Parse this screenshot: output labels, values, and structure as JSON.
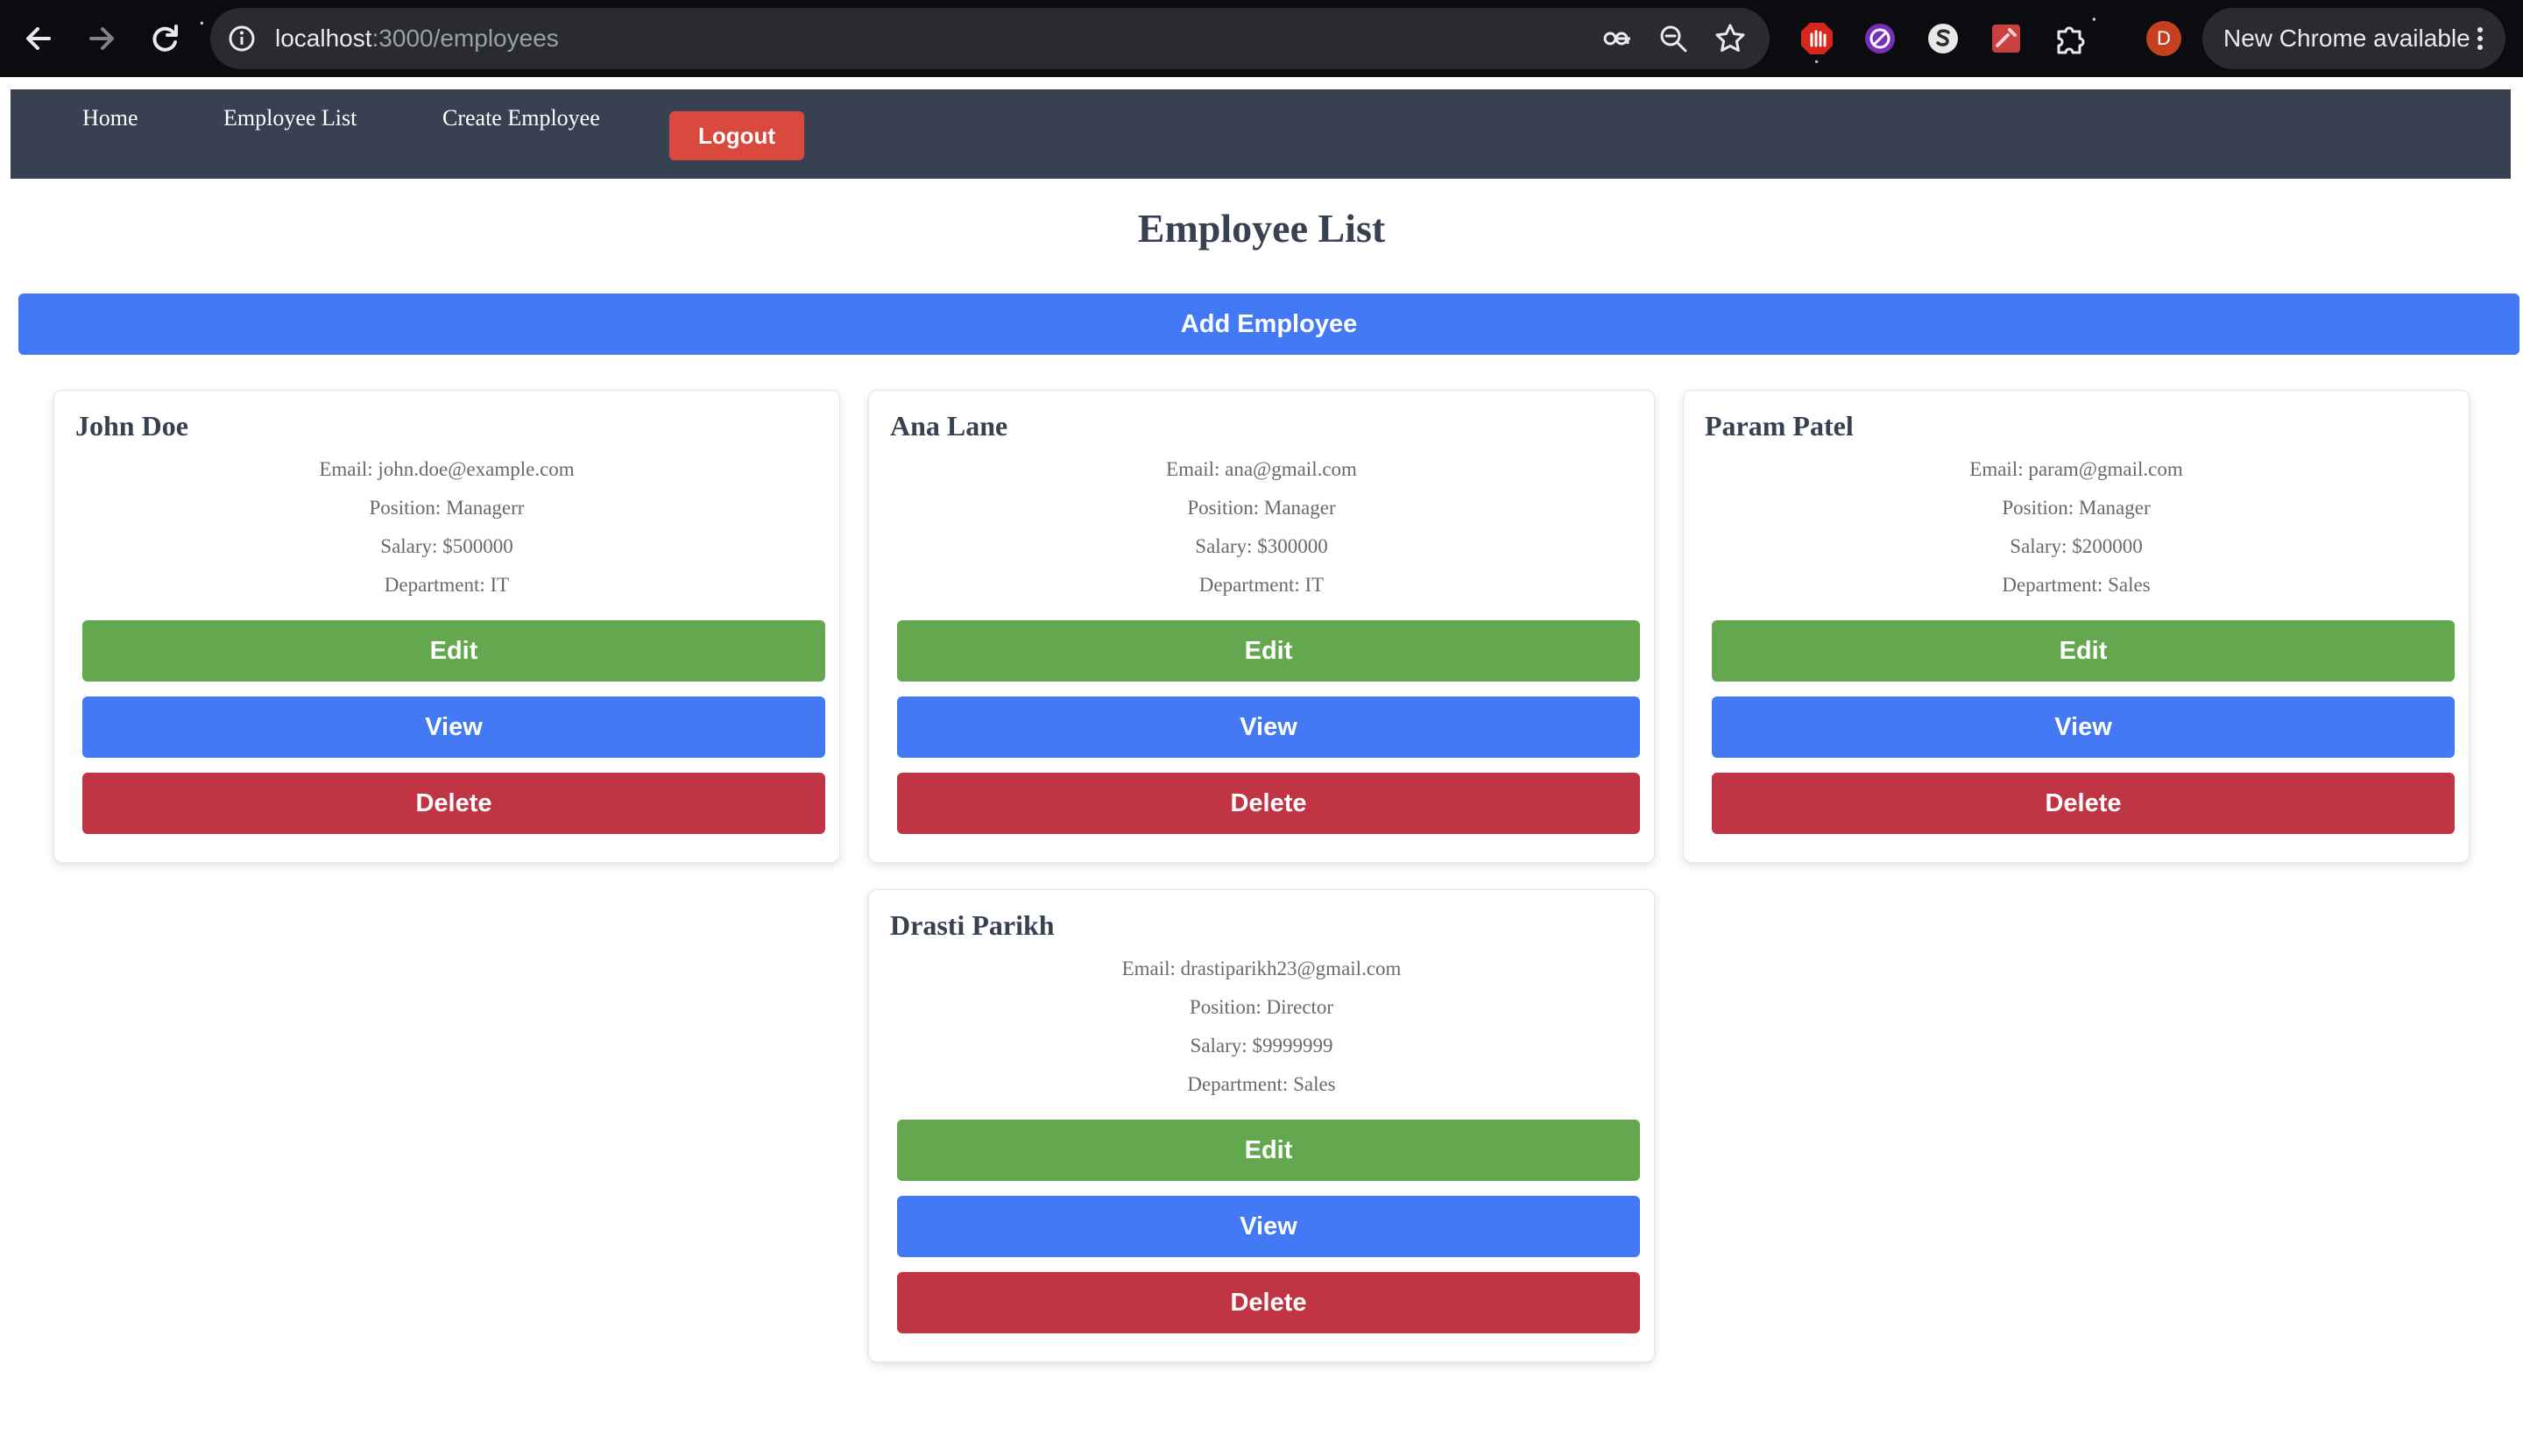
{
  "browser": {
    "url_host": "localhost",
    "url_path": ":3000/employees",
    "profile_initial": "D",
    "update_label": "New Chrome available",
    "icons": [
      "back-arrow-icon",
      "forward-arrow-icon",
      "reload-icon",
      "site-info-icon",
      "password-key-icon",
      "zoom-icon",
      "bookmark-star-icon",
      "extensions-icon",
      "more-menu-icon"
    ]
  },
  "navbar": {
    "links": [
      "Home",
      "Employee List",
      "Create Employee"
    ],
    "logout_label": "Logout"
  },
  "page": {
    "title": "Employee List",
    "add_label": "Add Employee"
  },
  "employees": [
    {
      "name": "John Doe",
      "email": "Email: john.doe@example.com",
      "position": "Position: Managerr",
      "salary": "Salary: $500000",
      "department": "Department: IT"
    },
    {
      "name": "Ana Lane",
      "email": "Email: ana@gmail.com",
      "position": "Position: Manager",
      "salary": "Salary: $300000",
      "department": "Department: IT"
    },
    {
      "name": "Param Patel",
      "email": "Email: param@gmail.com",
      "position": "Position: Manager",
      "salary": "Salary: $200000",
      "department": "Department: Sales"
    },
    {
      "name": "Drasti Parikh",
      "email": "Email: drastiparikh23@gmail.com",
      "position": "Position: Director",
      "salary": "Salary: $9999999",
      "department": "Department: Sales"
    }
  ],
  "actions": {
    "edit": "Edit",
    "view": "View",
    "delete": "Delete"
  },
  "colors": {
    "navbar": "#374151",
    "logout": "#d9493d",
    "primary": "#4479f5",
    "edit": "#63a74e",
    "delete": "#c13444"
  }
}
